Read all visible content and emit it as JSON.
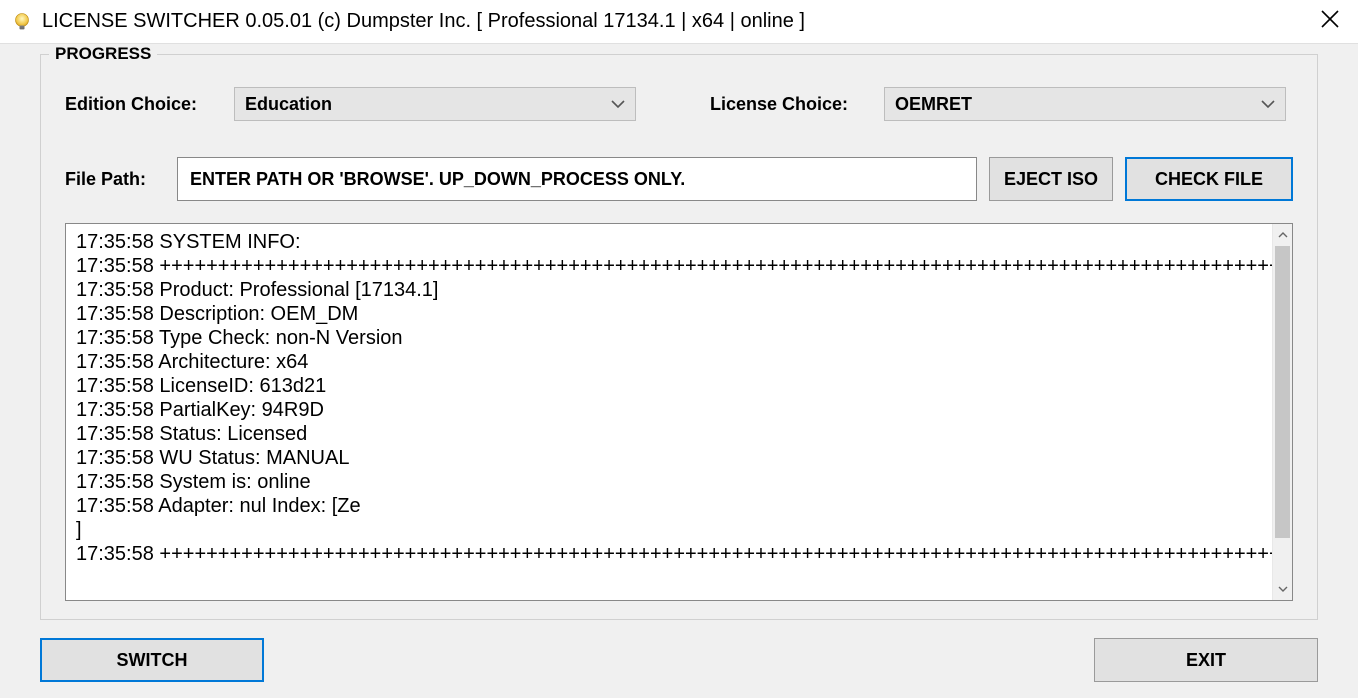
{
  "titlebar": {
    "title": "LICENSE SWITCHER 0.05.01 (c) Dumpster Inc. [ Professional 17134.1 | x64 | online ]"
  },
  "groupbox": {
    "title": "PROGRESS"
  },
  "labels": {
    "edition": "Edition Choice:",
    "license": "License Choice:",
    "filepath": "File Path:"
  },
  "selects": {
    "edition": "Education",
    "license": "OEMRET"
  },
  "inputs": {
    "filepath_placeholder": "ENTER PATH OR 'BROWSE'. UP_DOWN_PROCESS ONLY."
  },
  "buttons": {
    "eject": "EJECT ISO",
    "check": "CHECK FILE",
    "switch": "SWITCH",
    "exit": "EXIT"
  },
  "log_lines": [
    "17:35:58 SYSTEM INFO:",
    "17:35:58 ++++++++++++++++++++++++++++++++++++++++++++++++++++++++++++++++++++++++++++++++++++++++++++++++++++++++",
    "17:35:58 Product: Professional [17134.1]",
    "17:35:58 Description: OEM_DM",
    "17:35:58 Type Check: non-N Version",
    "17:35:58 Architecture: x64",
    "17:35:58 LicenseID: 613d21",
    "17:35:58 PartialKey: 94R9D",
    "17:35:58 Status: Licensed",
    "17:35:58 WU Status: MANUAL",
    "17:35:58 System is: online",
    "17:35:58 Adapter: nul Index: [Ze",
    "]",
    "17:35:58 ++++++++++++++++++++++++++++++++++++++++++++++++++++++++++++++++++++++++++++++++++++++++++++++++++++++++"
  ]
}
